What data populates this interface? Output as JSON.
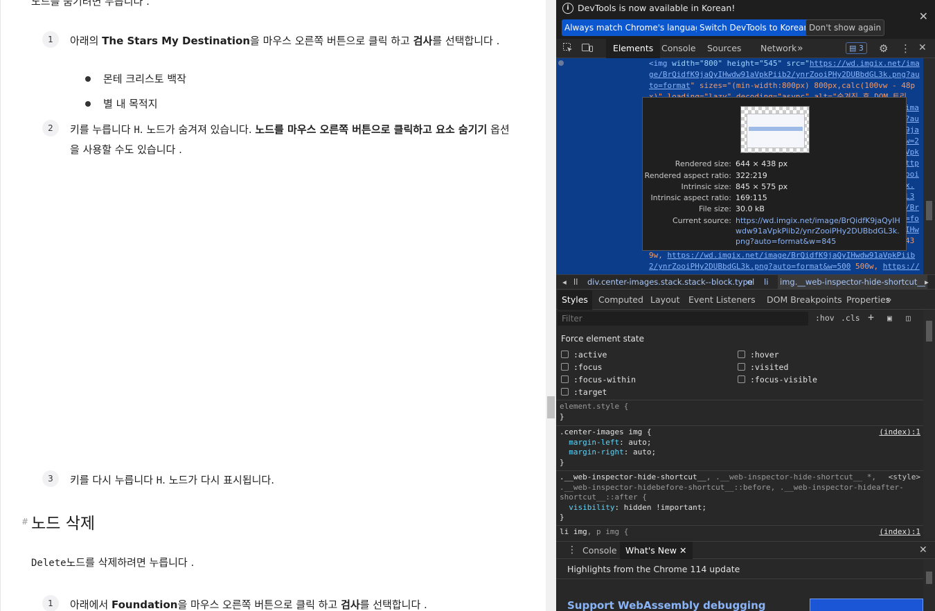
{
  "article": {
    "top_cut_text": "노드를 숨기려면 누릅니다 .",
    "items": [
      {
        "num": "1",
        "pre": "아래의 ",
        "bold1": "The Stars My Destination",
        "mid": "을 마우스 오른쪽 버튼으로 클릭 하고 ",
        "bold2": "검사",
        "post": "를 선택합니다 ."
      },
      {
        "num": "2",
        "pre": "키를 누릅니다 ",
        "key": "H",
        "mid": ". 노드가 숨겨져 있습니다. ",
        "bold1": "노드를 마우스 오른쪽 버튼으로 클릭하고 요소 숨기기",
        "post": " 옵션을 사용할 수도 있습니다 ."
      },
      {
        "num": "3",
        "pre": "키를 다시 누릅니다 ",
        "key": "H",
        "post": ". 노드가 다시 표시됩니다."
      },
      {
        "num": "1",
        "pre": "아래에서 ",
        "bold1": "Foundation",
        "mid": "을 마우스 오른쪽 버튼으로 클릭 하고 ",
        "bold2": "검사",
        "post": "를 선택합니다 ."
      }
    ],
    "bullets": [
      "몬테 크리스토 백작",
      "별 내 목적지"
    ],
    "heading_hash": "#",
    "heading": "노드 삭제",
    "delete_key": "Delete",
    "delete_text": "노드를 삭제하려면 누릅니다 ."
  },
  "devtools": {
    "infobar": {
      "message": "DevTools is now available in Korean!",
      "btn_match": "Always match Chrome's language",
      "btn_switch": "Switch DevTools to Korean",
      "btn_dont": "Don't show again",
      "close": "✕"
    },
    "main_tabs": [
      "Elements",
      "Console",
      "Sources",
      "Network"
    ],
    "more_tabs": "»",
    "issues_count": "3",
    "dom": {
      "line1_tag": "<img",
      "line1_attrs": " width=\"800\" height=\"545\" src=\"",
      "line1_url": "https://wd.imgix.net/ima",
      "line2": "ge/BrQidfK9jaQyIHwdw91aVpkPiib2/ynrZooiPHy2DUBbdGL3k.png?au",
      "line3_url": "to=format",
      "line3_rest": "\" sizes=\"(min-width:800px) 800px,calc(100vw - 48p",
      "line4": "x)\" loading=\"lazy\" decoding=\"async\" alt=\"숨겨진 후 DOM 트리",
      "right_frags": [
        "ima",
        "?au",
        "9ja",
        "w=2",
        "Vpk",
        "ttp",
        "ooi",
        "x.",
        "L3",
        "/Br",
        "=fo",
        "IHw",
        "43"
      ],
      "line_b1_val": "9w, ",
      "line_b1_url": "https://wd.imgix.net/image/BrQidfK9jaQyIHwdw91aVpkPiib",
      "line_b2_url": "2/ynrZooiPHy2DUBbdGL3k.png?auto=format&w=500",
      "line_b2_rest": " 500w, ",
      "line_b2_url2": "https://"
    },
    "tooltip": {
      "rendered_size_label": "Rendered size:",
      "rendered_size": "644 × 438 px",
      "rendered_ratio_label": "Rendered aspect ratio:",
      "rendered_ratio": "322:219",
      "intrinsic_size_label": "Intrinsic size:",
      "intrinsic_size": "845 × 575 px",
      "intrinsic_ratio_label": "Intrinsic aspect ratio:",
      "intrinsic_ratio": "169:115",
      "file_size_label": "File size:",
      "file_size": "30.0 kB",
      "current_source_label": "Current source:",
      "current_source": "https://wd.imgix.net/image/BrQidfK9jaQyIHwdw91aVpkPiib2/ynrZooiPHy2DUBbdGL3k.png?auto=format&w=845"
    },
    "breadcrumb": [
      "ll",
      "div.center-images.stack.stack--block.type",
      "ol",
      "li",
      "img.__web-inspector-hide-shortcut__"
    ],
    "styles_tabs": [
      "Styles",
      "Computed",
      "Layout",
      "Event Listeners",
      "DOM Breakpoints",
      "Properties"
    ],
    "filter_placeholder": "Filter",
    "filter_hov": ":hov",
    "filter_cls": ".cls",
    "force_title": "Force element state",
    "force_states": [
      ":active",
      ":focus",
      ":focus-within",
      ":target",
      ":hover",
      ":visited",
      ":focus-visible"
    ],
    "rules": {
      "r1_sel": "element.style {",
      "r2_sel": ".center-images img {",
      "r2_src": "(index):1",
      "r2_p1": "margin-left",
      "r2_v1": ": auto;",
      "r2_p2": "margin-right",
      "r2_v2": ": auto;",
      "r3_sel": ".__web-inspector-hide-shortcut__",
      "r3_sel_rest": ", .__web-inspector-hide-shortcut__ *,",
      "r3_line2": ".__web-inspector-hidebefore-shortcut__::before, .__web-inspector-hideafter-",
      "r3_line3": "shortcut__::after {",
      "r3_src": "<style>",
      "r3_p": "visibility",
      "r3_v": ": hidden !important;",
      "r4_sel": "li img",
      "r4_sel_rest": ", p img {",
      "r4_src": "(index):1",
      "close_brace": "}"
    },
    "drawer": {
      "tabs": [
        "Console",
        "What's New"
      ],
      "highlights": "Highlights from the Chrome 114 update",
      "card_title": "Support WebAssembly debugging"
    }
  }
}
